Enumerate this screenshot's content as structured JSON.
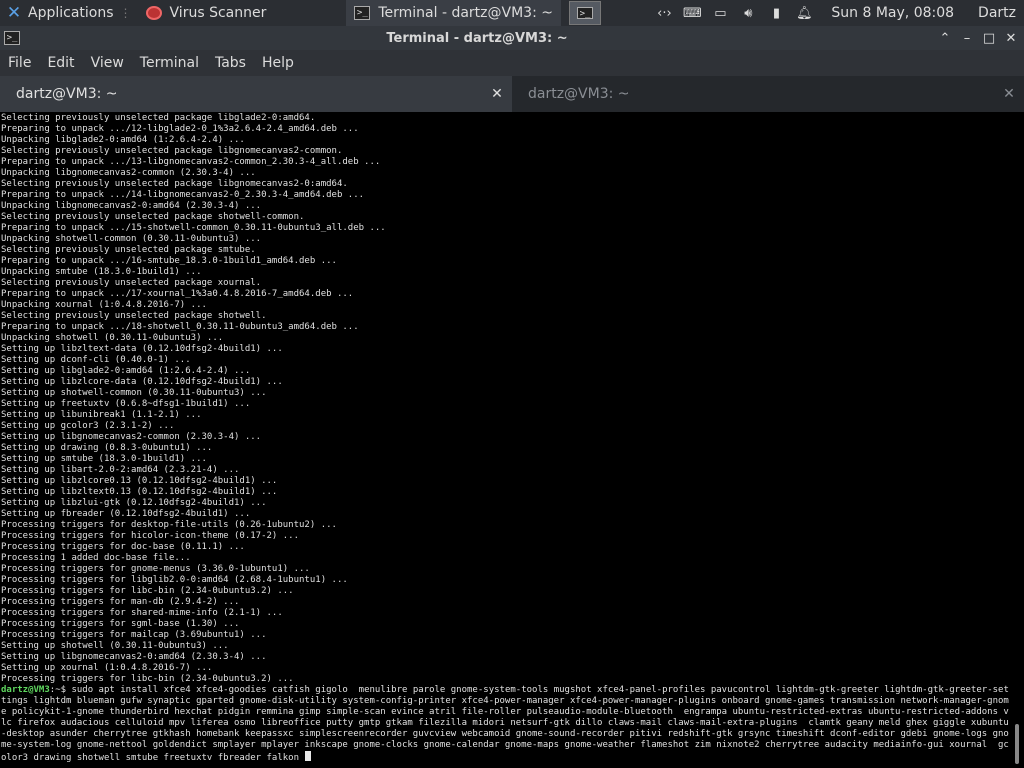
{
  "panel": {
    "applications_label": "Applications",
    "tasks": [
      {
        "label": "Virus Scanner",
        "icon": "virus-scanner-icon"
      },
      {
        "label": "Terminal - dartz@VM3: ~",
        "icon": "terminal-icon"
      }
    ],
    "clock": "Sun  8 May, 08:08",
    "user": "Dartz"
  },
  "window": {
    "title": "Terminal - dartz@VM3: ~"
  },
  "menu": [
    "File",
    "Edit",
    "View",
    "Terminal",
    "Tabs",
    "Help"
  ],
  "tabs": [
    {
      "label": "dartz@VM3: ~",
      "active": true
    },
    {
      "label": "dartz@VM3: ~",
      "active": false
    }
  ],
  "terminal": {
    "lines": [
      "Selecting previously unselected package libglade2-0:amd64.",
      "Preparing to unpack .../12-libglade2-0_1%3a2.6.4-2.4_amd64.deb ...",
      "Unpacking libglade2-0:amd64 (1:2.6.4-2.4) ...",
      "Selecting previously unselected package libgnomecanvas2-common.",
      "Preparing to unpack .../13-libgnomecanvas2-common_2.30.3-4_all.deb ...",
      "Unpacking libgnomecanvas2-common (2.30.3-4) ...",
      "Selecting previously unselected package libgnomecanvas2-0:amd64.",
      "Preparing to unpack .../14-libgnomecanvas2-0_2.30.3-4_amd64.deb ...",
      "Unpacking libgnomecanvas2-0:amd64 (2.30.3-4) ...",
      "Selecting previously unselected package shotwell-common.",
      "Preparing to unpack .../15-shotwell-common_0.30.11-0ubuntu3_all.deb ...",
      "Unpacking shotwell-common (0.30.11-0ubuntu3) ...",
      "Selecting previously unselected package smtube.",
      "Preparing to unpack .../16-smtube_18.3.0-1build1_amd64.deb ...",
      "Unpacking smtube (18.3.0-1build1) ...",
      "Selecting previously unselected package xournal.",
      "Preparing to unpack .../17-xournal_1%3a0.4.8.2016-7_amd64.deb ...",
      "Unpacking xournal (1:0.4.8.2016-7) ...",
      "Selecting previously unselected package shotwell.",
      "Preparing to unpack .../18-shotwell_0.30.11-0ubuntu3_amd64.deb ...",
      "Unpacking shotwell (0.30.11-0ubuntu3) ...",
      "Setting up libzltext-data (0.12.10dfsg2-4build1) ...",
      "Setting up dconf-cli (0.40.0-1) ...",
      "Setting up libglade2-0:amd64 (1:2.6.4-2.4) ...",
      "Setting up libzlcore-data (0.12.10dfsg2-4build1) ...",
      "Setting up shotwell-common (0.30.11-0ubuntu3) ...",
      "Setting up freetuxtv (0.6.8~dfsg1-1build1) ...",
      "Setting up libunibreak1 (1.1-2.1) ...",
      "Setting up gcolor3 (2.3.1-2) ...",
      "Setting up libgnomecanvas2-common (2.30.3-4) ...",
      "Setting up drawing (0.8.3-0ubuntu1) ...",
      "Setting up smtube (18.3.0-1build1) ...",
      "Setting up libart-2.0-2:amd64 (2.3.21-4) ...",
      "Setting up libzlcore0.13 (0.12.10dfsg2-4build1) ...",
      "Setting up libzltext0.13 (0.12.10dfsg2-4build1) ...",
      "Setting up libzlui-gtk (0.12.10dfsg2-4build1) ...",
      "Setting up fbreader (0.12.10dfsg2-4build1) ...",
      "Processing triggers for desktop-file-utils (0.26-1ubuntu2) ...",
      "Processing triggers for hicolor-icon-theme (0.17-2) ...",
      "Processing triggers for doc-base (0.11.1) ...",
      "Processing 1 added doc-base file...",
      "Processing triggers for gnome-menus (3.36.0-1ubuntu1) ...",
      "Processing triggers for libglib2.0-0:amd64 (2.68.4-1ubuntu1) ...",
      "Processing triggers for libc-bin (2.34-0ubuntu3.2) ...",
      "Processing triggers for man-db (2.9.4-2) ...",
      "Processing triggers for shared-mime-info (2.1-1) ...",
      "Processing triggers for sgml-base (1.30) ...",
      "Processing triggers for mailcap (3.69ubuntu1) ...",
      "Setting up shotwell (0.30.11-0ubuntu3) ...",
      "Setting up libgnomecanvas2-0:amd64 (2.30.3-4) ...",
      "Setting up xournal (1:0.4.8.2016-7) ...",
      "Processing triggers for libc-bin (2.34-0ubuntu3.2) ..."
    ],
    "prompt": "dartz@VM3",
    "prompt_suffix": ":~$ ",
    "command": "sudo apt install xfce4 xfce4-goodies catfish gigolo  menulibre parole gnome-system-tools mugshot xfce4-panel-profiles pavucontrol lightdm-gtk-greeter lightdm-gtk-greeter-settings lightdm blueman gufw synaptic gparted gnome-disk-utility system-config-printer xfce4-power-manager xfce4-power-manager-plugins onboard gnome-games transmission network-manager-gnome policykit-1-gnome thunderbird hexchat pidgin remmina gimp simple-scan evince atril file-roller pulseaudio-module-bluetooth  engrampa ubuntu-restricted-extras ubuntu-restricted-addons vlc firefox audacious celluloid mpv liferea osmo libreoffice putty gmtp gtkam filezilla midori netsurf-gtk dillo claws-mail claws-mail-extra-plugins  clamtk geany meld ghex giggle xubuntu-desktop asunder cherrytree gtkhash homebank keepassxc simplescreenrecorder guvcview webcamoid gnome-sound-recorder pitivi redshift-gtk grsync timeshift dconf-editor gdebi gnome-logs gnome-system-log gnome-nettool goldendict smplayer mplayer inkscape gnome-clocks gnome-calendar gnome-maps gnome-weather flameshot zim nixnote2 cherrytree audacity mediainfo-gui xournal  gcolor3 drawing shotwell smtube freetuxtv fbreader falkon "
  }
}
